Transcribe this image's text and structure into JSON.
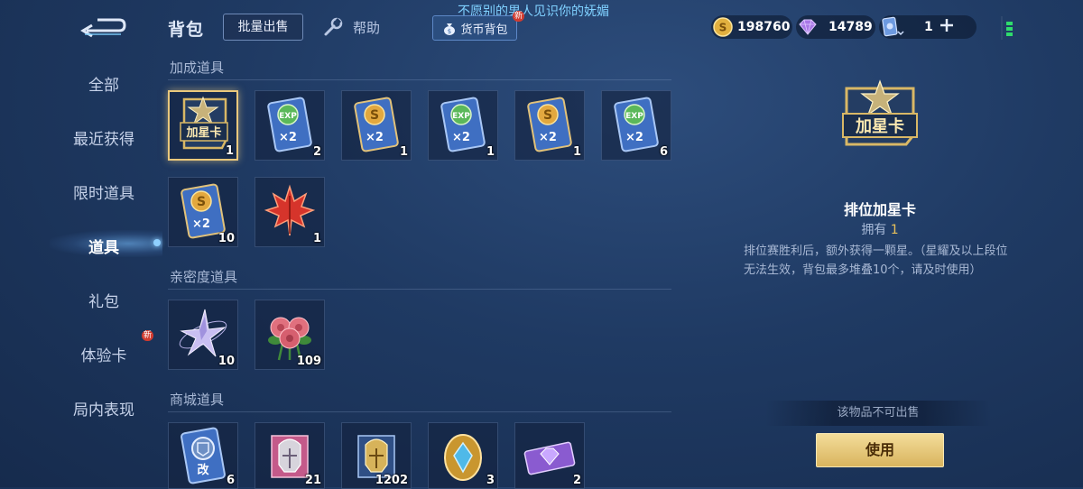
{
  "header": {
    "top_text": "不愿别的男人见识你的妩媚",
    "title": "背包",
    "bulk_sell_label": "批量出售",
    "help_label": "帮助",
    "currency_bag_label": "货币背包",
    "new_badge": "新"
  },
  "currencies": {
    "gold": "198760",
    "diamond": "14789",
    "ticket": "1"
  },
  "sidebar": {
    "items": [
      {
        "label": "全部"
      },
      {
        "label": "最近获得"
      },
      {
        "label": "限时道具"
      },
      {
        "label": "道具"
      },
      {
        "label": "礼包"
      },
      {
        "label": "体验卡"
      },
      {
        "label": "局内表现"
      }
    ],
    "active_index": 3,
    "new_badge": "新"
  },
  "sections": [
    {
      "title": "加成道具",
      "items": [
        {
          "icon": "star-card-icon",
          "card_text": "加星卡",
          "count": "1"
        },
        {
          "icon": "exp-card-icon",
          "card_text": "×2",
          "count": "2"
        },
        {
          "icon": "gold-card-icon",
          "card_text": "×2",
          "count": "1"
        },
        {
          "icon": "exp-card-icon",
          "card_text": "×2",
          "count": "1"
        },
        {
          "icon": "gold-card-icon",
          "card_text": "×2",
          "count": "1"
        },
        {
          "icon": "exp-card-icon",
          "card_text": "×2",
          "count": "6"
        },
        {
          "icon": "gold-card-icon",
          "card_text": "×2",
          "count": "10"
        },
        {
          "icon": "maple-leaf-icon",
          "count": "1"
        }
      ]
    },
    {
      "title": "亲密度道具",
      "items": [
        {
          "icon": "star-shard-icon",
          "count": "10"
        },
        {
          "icon": "rose-bouquet-icon",
          "count": "109"
        }
      ]
    },
    {
      "title": "商城道具",
      "items": [
        {
          "icon": "rename-card-icon",
          "card_text": "改",
          "count": "6"
        },
        {
          "icon": "pink-helmet-fragment-icon",
          "count": "21"
        },
        {
          "icon": "gold-helmet-fragment-icon",
          "count": "1202"
        },
        {
          "icon": "crystal-egg-icon",
          "count": "3"
        },
        {
          "icon": "diamond-ticket-icon",
          "count": "2"
        }
      ]
    }
  ],
  "detail": {
    "card_text": "加星卡",
    "name": "排位加星卡",
    "owned_label": "拥有",
    "owned_count": "1",
    "description": "排位赛胜利后，额外获得一颗星。（星耀及以上段位无法生效，背包最多堆叠10个，请及时使用）",
    "no_sale_text": "该物品不可出售",
    "use_label": "使用"
  },
  "colors": {
    "gold_border": "#e9c87c",
    "accent_blue": "#7fd0ff",
    "use_button": "#d9b45e"
  }
}
